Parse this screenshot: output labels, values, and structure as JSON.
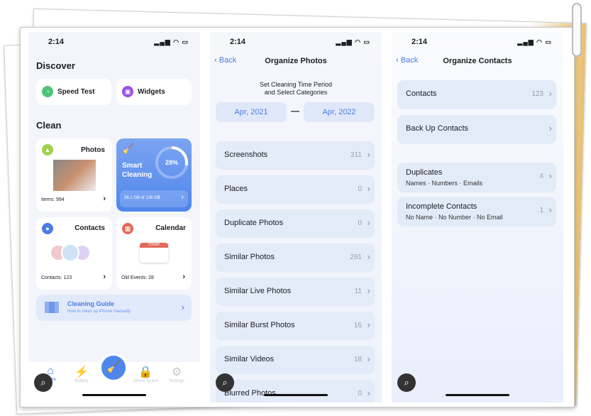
{
  "status_time": "2:14",
  "status_icons": "signal wifi battery",
  "home": {
    "discover_title": "Discover",
    "speed_test": "Speed Test",
    "widgets": "Widgets",
    "clean_title": "Clean",
    "photos": {
      "title": "Photos",
      "items": "Items: 994"
    },
    "smart": {
      "title1": "Smart",
      "title2": "Cleaning",
      "percent": "28%",
      "progress": 0.28,
      "storage": "36.1 GB of 128 GB"
    },
    "contacts": {
      "title": "Contacts",
      "count": "Contacts: 123"
    },
    "calendar": {
      "title": "Calendar",
      "today": "TODAY",
      "count": "Old Events: 28"
    },
    "guide": {
      "title": "Cleaning Guide",
      "subtitle": "How to clean up iPhone manually"
    },
    "tabs": [
      "Home",
      "Battery",
      "Secret Space",
      "Settings"
    ]
  },
  "photos_screen": {
    "back": "Back",
    "title": "Organize Photos",
    "subtitle1": "Set Cleaning Time Period",
    "subtitle2": "and Select Categories",
    "from": "Apr, 2021",
    "to": "Apr, 2022",
    "dash": "—",
    "rows": [
      {
        "label": "Screenshots",
        "count": "311"
      },
      {
        "label": "Places",
        "count": "0"
      },
      {
        "label": "Duplicate Photos",
        "count": "0"
      },
      {
        "label": "Similar Photos",
        "count": "291"
      },
      {
        "label": "Similar Live Photos",
        "count": "11"
      },
      {
        "label": "Similar Burst Photos",
        "count": "16"
      },
      {
        "label": "Similar Videos",
        "count": "18"
      },
      {
        "label": "Blurred Photos",
        "count": "0"
      }
    ]
  },
  "contacts_screen": {
    "back": "Back",
    "title": "Organize Contacts",
    "contacts": {
      "label": "Contacts",
      "count": "123"
    },
    "backup": {
      "label": "Back Up Contacts"
    },
    "duplicates": {
      "label": "Duplicates",
      "sub": "Names · Numbers · Emails",
      "count": "4"
    },
    "incomplete": {
      "label": "Incomplete Contacts",
      "sub": "No Name · No Number · No Email",
      "count": "1"
    }
  },
  "colors": {
    "accent": "#4b7be6",
    "panel_bg": "#f3f5fb",
    "row_bg": "#e3eaf8"
  }
}
